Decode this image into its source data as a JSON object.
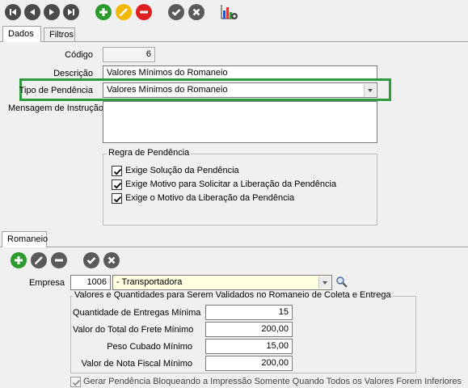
{
  "toolbar": {
    "icons": [
      "first-icon",
      "previous-icon",
      "next-icon",
      "last-icon",
      "add-icon",
      "edit-icon",
      "delete-icon",
      "confirm-icon",
      "cancel-icon",
      "chart-settings-icon"
    ]
  },
  "tabs": [
    {
      "label": "Dados"
    },
    {
      "label": "Filtros"
    }
  ],
  "form": {
    "codigo_label": "Código",
    "codigo_value": "6",
    "descricao_label": "Descrição",
    "descricao_value": "Valores Mínimos do Romaneio",
    "tipo_label": "Tipo de Pendência",
    "tipo_value": "Valores Mínimos do Romaneio",
    "mensagem_label": "Mensagem de Instrução",
    "mensagem_value": ""
  },
  "regra": {
    "title": "Regra de Pendência",
    "items": [
      {
        "label": "Exige Solução da Pendência",
        "checked": true
      },
      {
        "label": "Exige Motivo para Solicitar a Liberação da Pendência",
        "checked": true
      },
      {
        "label": "Exige o Motivo da Liberação da Pendência",
        "checked": true
      }
    ]
  },
  "romaneio": {
    "tab_label": "Romaneio",
    "empresa_label": "Empresa",
    "empresa_code": "1006",
    "empresa_name": "- Transportadora",
    "group_title": "Valores e Quantidades para Serem Validados no Romaneio de Coleta e Entrega",
    "rows": [
      {
        "label": "Quantidade de Entregas Mínima",
        "value": "15"
      },
      {
        "label": "Valor do Total do Frete Mínimo",
        "value": "200,00"
      },
      {
        "label": "Peso Cubado Mínimo",
        "value": "15,00"
      },
      {
        "label": "Valor de Nota Fiscal Mínimo",
        "value": "200,00"
      }
    ],
    "gerar_label": "Gerar Pendência Bloqueando a Impressão Somente Quando Todos os Valores Forem Inferiores",
    "gerar_checked": true
  },
  "colors": {
    "accent_highlight": "#2a9d3a",
    "add": "#2d9a2d",
    "edit": "#f5b800",
    "delete": "#e02020",
    "neutral": "#5a5a5a",
    "empresa_bg": "#ffffe1"
  }
}
